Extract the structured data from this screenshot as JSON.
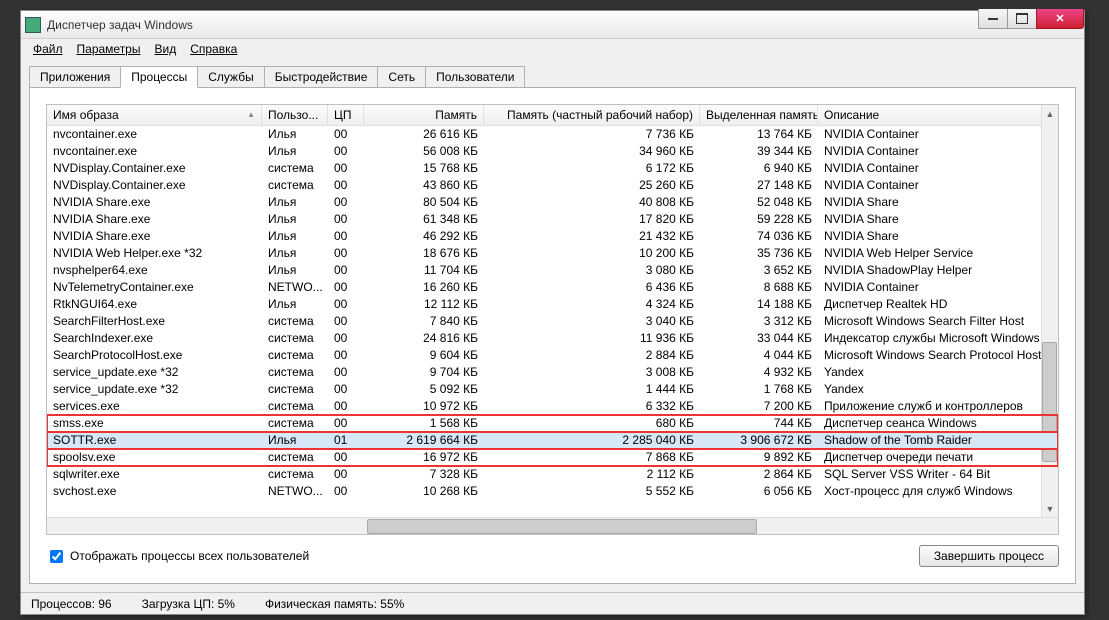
{
  "window": {
    "title": "Диспетчер задач Windows"
  },
  "menu": [
    "Файл",
    "Параметры",
    "Вид",
    "Справка"
  ],
  "tabs": [
    "Приложения",
    "Процессы",
    "Службы",
    "Быстродействие",
    "Сеть",
    "Пользователи"
  ],
  "active_tab": 1,
  "columns": [
    "Имя образа",
    "Пользо...",
    "ЦП",
    "Память",
    "Память (частный рабочий набор)",
    "Выделенная память",
    "Описание"
  ],
  "rows": [
    {
      "name": "nvcontainer.exe",
      "user": "Илья",
      "cpu": "00",
      "mem": "26 616 КБ",
      "pws": "7 736 КБ",
      "commit": "13 764 КБ",
      "desc": "NVIDIA Container"
    },
    {
      "name": "nvcontainer.exe",
      "user": "Илья",
      "cpu": "00",
      "mem": "56 008 КБ",
      "pws": "34 960 КБ",
      "commit": "39 344 КБ",
      "desc": "NVIDIA Container"
    },
    {
      "name": "NVDisplay.Container.exe",
      "user": "система",
      "cpu": "00",
      "mem": "15 768 КБ",
      "pws": "6 172 КБ",
      "commit": "6 940 КБ",
      "desc": "NVIDIA Container"
    },
    {
      "name": "NVDisplay.Container.exe",
      "user": "система",
      "cpu": "00",
      "mem": "43 860 КБ",
      "pws": "25 260 КБ",
      "commit": "27 148 КБ",
      "desc": "NVIDIA Container"
    },
    {
      "name": "NVIDIA Share.exe",
      "user": "Илья",
      "cpu": "00",
      "mem": "80 504 КБ",
      "pws": "40 808 КБ",
      "commit": "52 048 КБ",
      "desc": "NVIDIA Share"
    },
    {
      "name": "NVIDIA Share.exe",
      "user": "Илья",
      "cpu": "00",
      "mem": "61 348 КБ",
      "pws": "17 820 КБ",
      "commit": "59 228 КБ",
      "desc": "NVIDIA Share"
    },
    {
      "name": "NVIDIA Share.exe",
      "user": "Илья",
      "cpu": "00",
      "mem": "46 292 КБ",
      "pws": "21 432 КБ",
      "commit": "74 036 КБ",
      "desc": "NVIDIA Share"
    },
    {
      "name": "NVIDIA Web Helper.exe *32",
      "user": "Илья",
      "cpu": "00",
      "mem": "18 676 КБ",
      "pws": "10 200 КБ",
      "commit": "35 736 КБ",
      "desc": "NVIDIA Web Helper Service"
    },
    {
      "name": "nvsphelper64.exe",
      "user": "Илья",
      "cpu": "00",
      "mem": "11 704 КБ",
      "pws": "3 080 КБ",
      "commit": "3 652 КБ",
      "desc": "NVIDIA ShadowPlay Helper"
    },
    {
      "name": "NvTelemetryContainer.exe",
      "user": "NETWO...",
      "cpu": "00",
      "mem": "16 260 КБ",
      "pws": "6 436 КБ",
      "commit": "8 688 КБ",
      "desc": "NVIDIA Container"
    },
    {
      "name": "RtkNGUI64.exe",
      "user": "Илья",
      "cpu": "00",
      "mem": "12 112 КБ",
      "pws": "4 324 КБ",
      "commit": "14 188 КБ",
      "desc": "Диспетчер Realtek HD"
    },
    {
      "name": "SearchFilterHost.exe",
      "user": "система",
      "cpu": "00",
      "mem": "7 840 КБ",
      "pws": "3 040 КБ",
      "commit": "3 312 КБ",
      "desc": "Microsoft Windows Search Filter Host"
    },
    {
      "name": "SearchIndexer.exe",
      "user": "система",
      "cpu": "00",
      "mem": "24 816 КБ",
      "pws": "11 936 КБ",
      "commit": "33 044 КБ",
      "desc": "Индексатор службы Microsoft Windows Sea"
    },
    {
      "name": "SearchProtocolHost.exe",
      "user": "система",
      "cpu": "00",
      "mem": "9 604 КБ",
      "pws": "2 884 КБ",
      "commit": "4 044 КБ",
      "desc": "Microsoft Windows Search Protocol Host"
    },
    {
      "name": "service_update.exe *32",
      "user": "система",
      "cpu": "00",
      "mem": "9 704 КБ",
      "pws": "3 008 КБ",
      "commit": "4 932 КБ",
      "desc": "Yandex"
    },
    {
      "name": "service_update.exe *32",
      "user": "система",
      "cpu": "00",
      "mem": "5 092 КБ",
      "pws": "1 444 КБ",
      "commit": "1 768 КБ",
      "desc": "Yandex"
    },
    {
      "name": "services.exe",
      "user": "система",
      "cpu": "00",
      "mem": "10 972 КБ",
      "pws": "6 332 КБ",
      "commit": "7 200 КБ",
      "desc": "Приложение служб и контроллеров"
    },
    {
      "name": "smss.exe",
      "user": "система",
      "cpu": "00",
      "mem": "1 568 КБ",
      "pws": "680 КБ",
      "commit": "744 КБ",
      "desc": "Диспетчер сеанса  Windows",
      "hi": true
    },
    {
      "name": "SOTTR.exe",
      "user": "Илья",
      "cpu": "01",
      "mem": "2 619 664 КБ",
      "pws": "2 285 040 КБ",
      "commit": "3 906 672 КБ",
      "desc": "Shadow of the Tomb Raider",
      "sel": true,
      "hi": true
    },
    {
      "name": "spoolsv.exe",
      "user": "система",
      "cpu": "00",
      "mem": "16 972 КБ",
      "pws": "7 868 КБ",
      "commit": "9 892 КБ",
      "desc": "Диспетчер очереди печати",
      "hi": true
    },
    {
      "name": "sqlwriter.exe",
      "user": "система",
      "cpu": "00",
      "mem": "7 328 КБ",
      "pws": "2 112 КБ",
      "commit": "2 864 КБ",
      "desc": "SQL Server VSS Writer - 64 Bit"
    },
    {
      "name": "svchost.exe",
      "user": "NETWO...",
      "cpu": "00",
      "mem": "10 268 КБ",
      "pws": "5 552 КБ",
      "commit": "6 056 КБ",
      "desc": "Хост-процесс для служб Windows"
    }
  ],
  "checkbox_label": "Отображать процессы всех пользователей",
  "end_button": "Завершить процесс",
  "status": {
    "procs": "Процессов: 96",
    "cpu": "Загрузка ЦП: 5%",
    "mem": "Физическая память: 55%"
  }
}
